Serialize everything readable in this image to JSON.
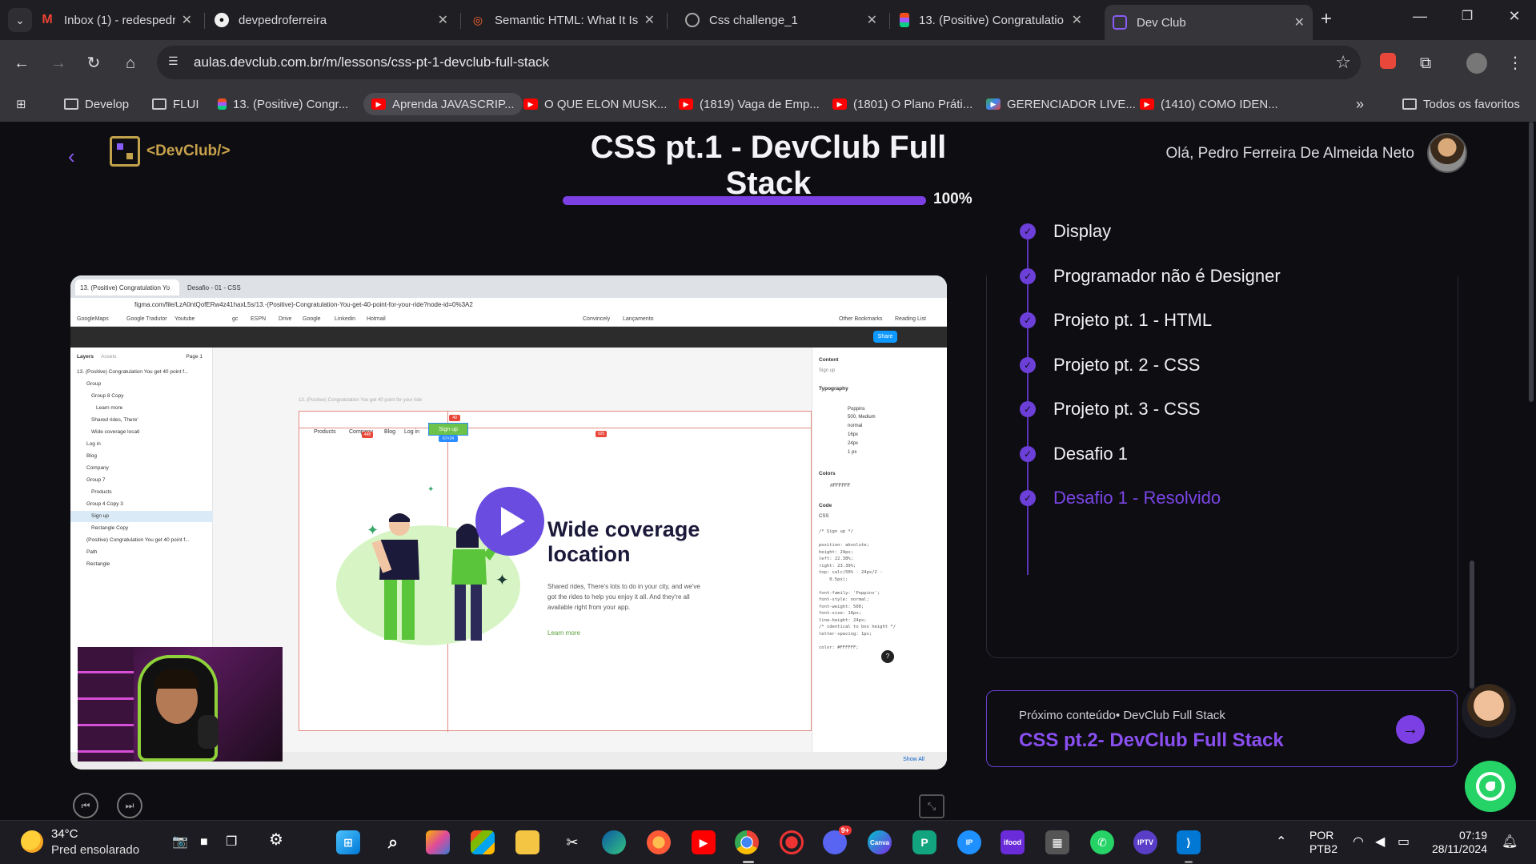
{
  "browser": {
    "tabs": [
      {
        "label": "Inbox (1) - redespedroferre",
        "favicon": "gmail-icon",
        "color": "#ea4335"
      },
      {
        "label": "devpedroferreira",
        "favicon": "github-icon",
        "color": "#f0f0f0"
      },
      {
        "label": "Semantic HTML: What It Is",
        "favicon": "semrush-icon",
        "color": "#ff642d"
      },
      {
        "label": "Css challenge_1",
        "favicon": "globe-icon",
        "color": "#9aa0a6"
      },
      {
        "label": "13. (Positive) Congratulatio",
        "favicon": "figma-icon",
        "color": "#a259ff"
      },
      {
        "label": "Dev Club",
        "favicon": "devclub-icon",
        "color": "#8a5cf6"
      }
    ],
    "url": "aulas.devclub.com.br/m/lessons/css-pt-1-devclub-full-stack",
    "bookmarks": [
      {
        "label": "Develop",
        "type": "folder"
      },
      {
        "label": "FLUI",
        "type": "folder"
      },
      {
        "label": "13. (Positive) Congr...",
        "type": "figma"
      },
      {
        "label": "Aprenda JAVASCRIP...",
        "type": "youtube"
      },
      {
        "label": "O QUE ELON MUSK...",
        "type": "youtube"
      },
      {
        "label": "(1819) Vaga de Emp...",
        "type": "youtube"
      },
      {
        "label": "(1801) O Plano Práti...",
        "type": "youtube"
      },
      {
        "label": "GERENCIADOR LIVE...",
        "type": "play"
      },
      {
        "label": "(1410) COMO IDEN...",
        "type": "youtube"
      }
    ],
    "bookmarks_more": "»",
    "all_bookmarks": "Todos os favoritos"
  },
  "header": {
    "logo": "<DevClub/>",
    "title": "CSS pt.1 - DevClub Full Stack",
    "progress_label": "100%",
    "progress_fraction": 1.0,
    "greeting": "Olá, Pedro Ferreira De Almeida Neto"
  },
  "video": {
    "tabs": [
      "13. (Positive) Congratulation Yo",
      "Desafio - 01 - CSS"
    ],
    "url": "figma.com/file/LzA0ntQofERw4z41haxL5s/13.-(Positive)-Congratulation-You-get-40-point-for-your-ride?node-id=0%3A2",
    "bookmarks": [
      "GoogleMaps",
      "Google Tradutor",
      "Youtube",
      "gc",
      "ESPN",
      "Drive",
      "Google",
      "Linkedin",
      "Hotmail",
      "Convincely",
      "Lançamento",
      "Other Bookmarks",
      "Reading List"
    ],
    "share_label": "Share",
    "layers_tab": "Layers",
    "assets_tab": "Assets",
    "page_label": "Page 1",
    "layers": [
      "13. (Positive) Congratulation You get 40 point f...",
      "Group",
      "Group 8 Copy",
      "Learn more",
      "Shared rides, There'",
      "Wide coverage locati",
      "Log in",
      "Blog",
      "Company",
      "Group 7",
      "Products",
      "Group 4 Copy 3",
      "Sign up",
      "Rectangle Copy",
      "(Positive) Congratulation You get 40 point f...",
      "Path",
      "Rectangle"
    ],
    "frame_label": "13. (Positive) Congratulation You get 40 point for your ride",
    "nav": [
      "Products",
      "Company",
      "Blog",
      "Log in"
    ],
    "signup": "Sign up",
    "badges": [
      "40",
      "448",
      "925",
      "67×24",
      "778"
    ],
    "heading": "Wide coverage location",
    "body": "Shared rides, There's lots to do in your city, and we've got the rides to help you enjoy it all. And they're all available right from your app.",
    "learn_more": "Learn more",
    "props": {
      "content_h": "Content",
      "content_v": "Sign up",
      "typography_h": "Typography",
      "font": "Poppins",
      "weight": "500, Medium",
      "style": "normal",
      "size": "16px",
      "line_height": "24px",
      "letter": "1 px",
      "colors_h": "Colors",
      "color_hex": "#FFFFFF",
      "code_h": "Code",
      "code_lang": "CSS",
      "code": "/* Sign up */\n\nposition: absolute;\nheight: 24px;\nleft: 22.38%;\nright: 23.39%;\ntop: calc(50% - 24px/2 -\n    0.5px);\n\nfont-family: 'Poppins';\nfont-style: normal;\nfont-weight: 500;\nfont-size: 16px;\nline-height: 24px;\n/* identical to box height */\nletter-spacing: 1px;\n\ncolor: #FFFFFF;"
    },
    "show_all": "Show All"
  },
  "modules": [
    {
      "label": "Display",
      "current": false
    },
    {
      "label": "Programador não é Designer",
      "current": false
    },
    {
      "label": "Projeto pt. 1 - HTML",
      "current": false
    },
    {
      "label": "Projeto pt. 2 - CSS",
      "current": false
    },
    {
      "label": "Projeto pt. 3 - CSS",
      "current": false
    },
    {
      "label": "Desafio 1",
      "current": false
    },
    {
      "label": "Desafio 1 - Resolvido",
      "current": true
    }
  ],
  "next": {
    "kicker": "Próximo conteúdo• DevClub Full Stack",
    "title": "CSS pt.2- DevClub Full Stack"
  },
  "taskbar": {
    "temp": "34°C",
    "weather": "Pred ensolarado",
    "lang": "POR",
    "layout": "PTB2",
    "time": "07:19",
    "date": "28/11/2024",
    "discord_badge": "9+"
  },
  "colors": {
    "accent": "#7b3fe4",
    "bg": "#0d0d12",
    "chrome": "#35353a"
  }
}
